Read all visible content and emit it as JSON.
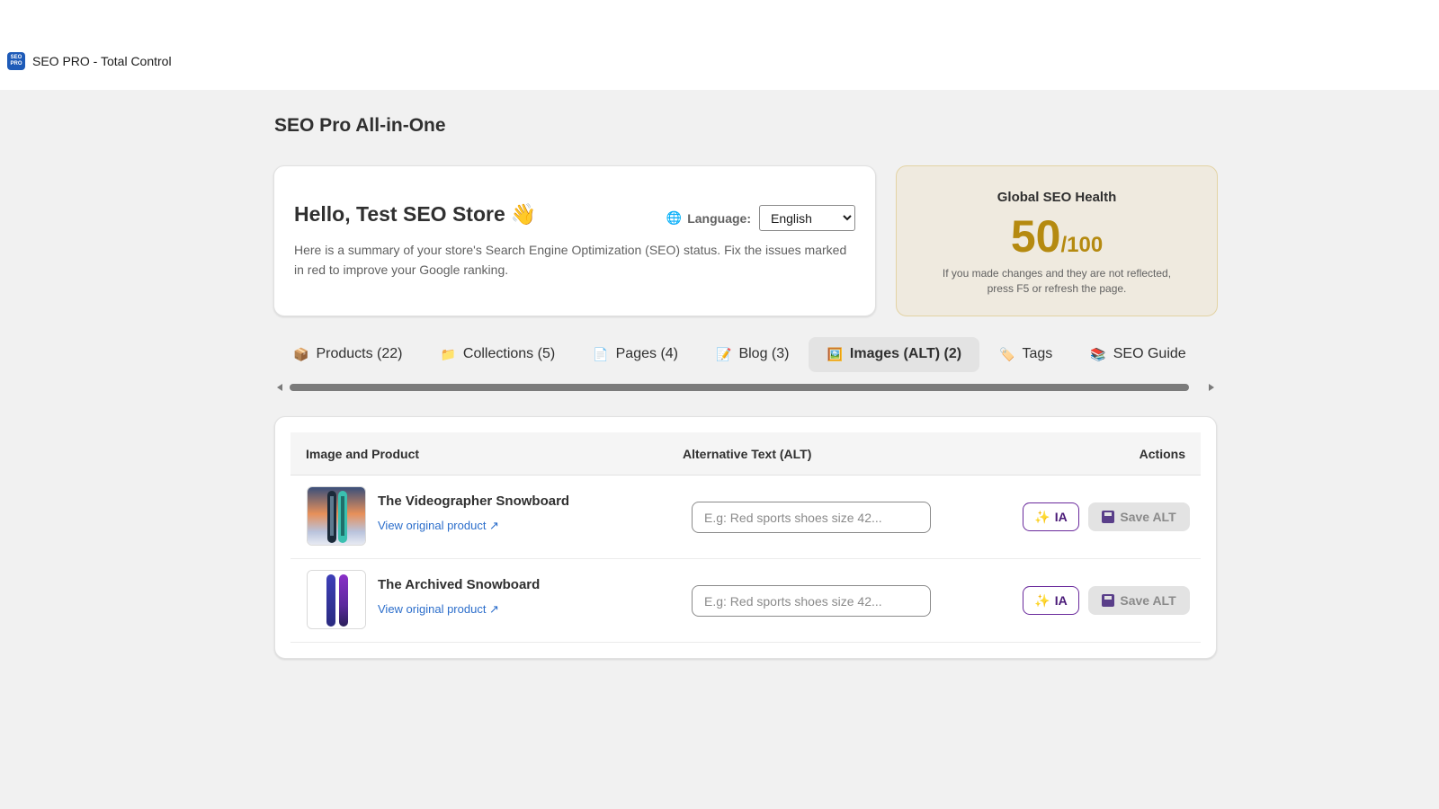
{
  "app": {
    "title": "SEO PRO - Total Control",
    "logo_text": "SEO PRO"
  },
  "page": {
    "title": "SEO Pro All-in-One"
  },
  "welcome": {
    "greeting": "Hello, Test SEO Store",
    "greeting_emoji": "👋",
    "summary": "Here is a summary of your store's Search Engine Optimization (SEO) status. Fix the issues marked in red to improve your Google ranking.",
    "language_label": "Language:",
    "language_value": "English",
    "language_options": [
      "English"
    ]
  },
  "health": {
    "title": "Global SEO Health",
    "score": "50",
    "score_max": "/100",
    "note": "If you made changes and they are not reflected, press F5 or refresh the page.",
    "accent_color": "#b58a10"
  },
  "tabs": [
    {
      "label": "Products (22)",
      "icon": "📦",
      "icon_name": "package-icon",
      "active": false
    },
    {
      "label": "Collections (5)",
      "icon": "📁",
      "icon_name": "folder-icon",
      "active": false
    },
    {
      "label": "Pages (4)",
      "icon": "📄",
      "icon_name": "page-icon",
      "active": false
    },
    {
      "label": "Blog (3)",
      "icon": "📝",
      "icon_name": "memo-icon",
      "active": false
    },
    {
      "label": "Images (ALT) (2)",
      "icon": "🖼️",
      "icon_name": "picture-icon",
      "active": true
    },
    {
      "label": "Tags",
      "icon": "🏷️",
      "icon_name": "tag-icon",
      "active": false
    },
    {
      "label": "SEO Guide",
      "icon": "📚",
      "icon_name": "books-icon",
      "active": false
    }
  ],
  "table": {
    "headers": {
      "image_product": "Image and Product",
      "alt_text": "Alternative Text (ALT)",
      "actions": "Actions"
    },
    "rows": [
      {
        "name": "The Videographer Snowboard",
        "link": "View original product ↗",
        "alt_value": "",
        "alt_placeholder": "E.g: Red sports shoes size 42..."
      },
      {
        "name": "The Archived Snowboard",
        "link": "View original product ↗",
        "alt_value": "",
        "alt_placeholder": "E.g: Red sports shoes size 42..."
      }
    ],
    "ia_label": "IA",
    "save_label": "Save ALT"
  }
}
